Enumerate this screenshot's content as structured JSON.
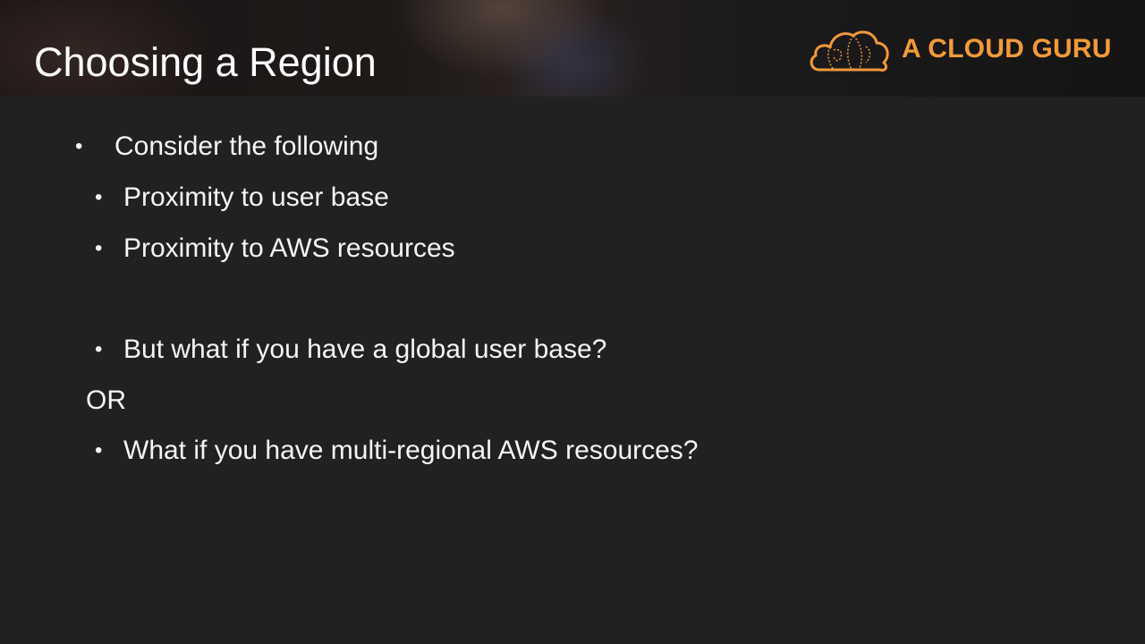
{
  "slide": {
    "title": "Choosing a Region",
    "brand_name": "A CLOUD GURU",
    "brand_logo_icon": "cloud-logo-icon",
    "bullet_glyph": "•",
    "points": [
      "Consider the following",
      "Proximity to user base",
      "Proximity to AWS resources",
      "But what if you have a global user base?",
      "What if you have multi-regional AWS resources?"
    ],
    "connector": "OR"
  },
  "colors": {
    "background": "#212121",
    "brand_accent": "#f29a3a",
    "text": "#f5f5f5"
  }
}
